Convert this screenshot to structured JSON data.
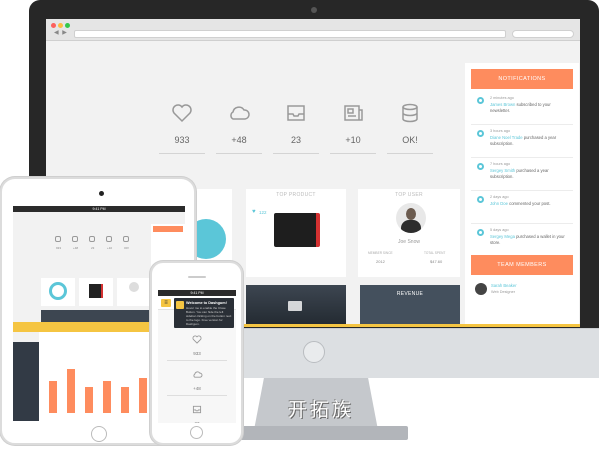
{
  "desktop": {
    "address_placeholder": "",
    "stats": [
      {
        "icon": "heart-icon",
        "value": "933"
      },
      {
        "icon": "cloud-icon",
        "value": "+48"
      },
      {
        "icon": "inbox-icon",
        "value": "23"
      },
      {
        "icon": "newspaper-icon",
        "value": "+10"
      },
      {
        "icon": "database-icon",
        "value": "OK!"
      }
    ],
    "cards": {
      "top_product_title": "TOP PRODUCT",
      "top_product_likes": "122",
      "top_user_title": "TOP USER",
      "top_user_name": "Joe Snow",
      "top_user_stat1_label": "MEMBER SINCE",
      "top_user_stat1_value": "2012",
      "top_user_stat2_label": "TOTAL SPENT",
      "top_user_stat2_value": "$47.60",
      "revenue_title": "REVENUE"
    },
    "notifications": {
      "title": "NOTIFICATIONS",
      "items": [
        {
          "time": "2 minutes ago",
          "user": "James Brown",
          "text": "subscribed to your newsletter."
        },
        {
          "time": "3 hours ago",
          "user": "Diane Noel Trade",
          "text": "purchased a year subscription."
        },
        {
          "time": "7 hours ago",
          "user": "Sergey Smith",
          "text": "purchased a year subscription."
        },
        {
          "time": "2 days ago",
          "user": "John Doe",
          "text": "commented your post."
        },
        {
          "time": "5 days ago",
          "user": "Sergey Mega",
          "text": "purchased a wallet in your store."
        }
      ]
    },
    "team": {
      "title": "TEAM MEMBERS",
      "member_name": "Sarah Beaker",
      "member_role": "Web Designer"
    }
  },
  "tablet": {
    "status_time": "9:41 PM",
    "bars": [
      0.55,
      0.75,
      0.45,
      0.55,
      0.45,
      0.6,
      0.85
    ],
    "stat_values": [
      "933",
      "+48",
      "23",
      "+10",
      "OK!"
    ]
  },
  "phone": {
    "status_time": "9:41 PM",
    "popup_title": "Welcome to Dashgum!",
    "popup_text": "Hover me to enable the Close Button. You can hide the left sidebar clicking on the button next to the logo. Free version for Dashgum.",
    "stats": [
      "933",
      "+48",
      "23"
    ]
  },
  "watermark": "开拓族",
  "colors": {
    "accent_orange": "#fe8c5e",
    "accent_cyan": "#5bc6d8",
    "accent_yellow": "#f5c542",
    "dark_panel": "#44505d"
  }
}
